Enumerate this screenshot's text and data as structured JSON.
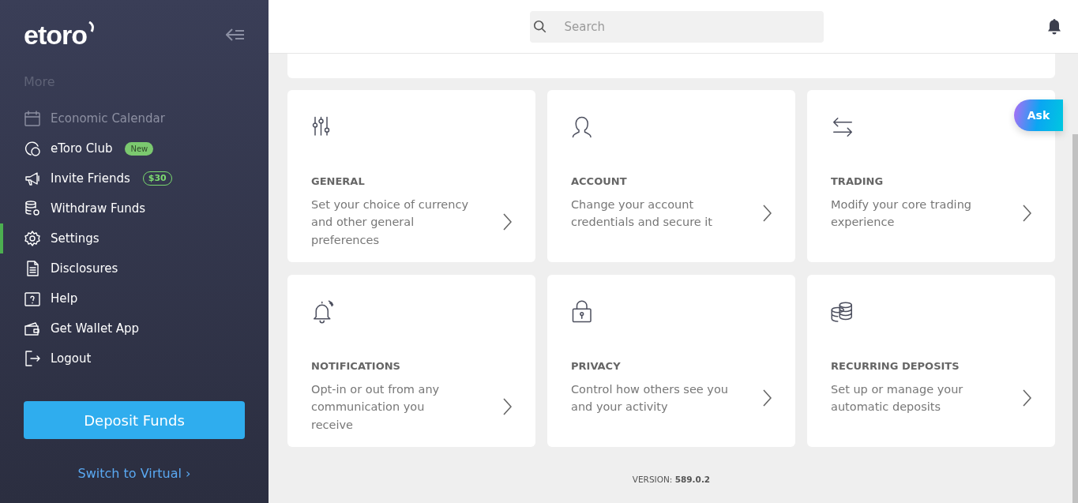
{
  "sidebar": {
    "logo": "etoro",
    "section_title": "More",
    "items": [
      {
        "label": "Economic Calendar",
        "selected": false,
        "dimmed": true
      },
      {
        "label": "eToro Club",
        "selected": false,
        "dimmed": false,
        "badge": {
          "text": "New",
          "kind": "filled"
        }
      },
      {
        "label": "Invite Friends",
        "selected": false,
        "dimmed": false,
        "badge": {
          "text": "$30",
          "kind": "outline"
        }
      },
      {
        "label": "Withdraw Funds",
        "selected": false,
        "dimmed": false
      },
      {
        "label": "Settings",
        "selected": true,
        "dimmed": false
      },
      {
        "label": "Disclosures",
        "selected": false,
        "dimmed": false
      },
      {
        "label": "Help",
        "selected": false,
        "dimmed": false
      },
      {
        "label": "Get Wallet App",
        "selected": false,
        "dimmed": false
      },
      {
        "label": "Logout",
        "selected": false,
        "dimmed": false
      }
    ],
    "deposit_button": "Deposit Funds",
    "switch_link": "Switch to Virtual ›"
  },
  "search": {
    "placeholder": "Search"
  },
  "ask_button": "Ask",
  "cards": [
    {
      "title": "GENERAL",
      "description": "Set your choice of currency and other general preferences"
    },
    {
      "title": "ACCOUNT",
      "description": "Change your account credentials and secure it"
    },
    {
      "title": "TRADING",
      "description": "Modify your core trading experience"
    },
    {
      "title": "NOTIFICATIONS",
      "description": "Opt-in or out from any communication you receive"
    },
    {
      "title": "PRIVACY",
      "description": "Control how others see you and your activity"
    },
    {
      "title": "RECURRING DEPOSITS",
      "description": "Set up or manage your automatic deposits"
    }
  ],
  "version": "VERSION: **589.0.2**"
}
